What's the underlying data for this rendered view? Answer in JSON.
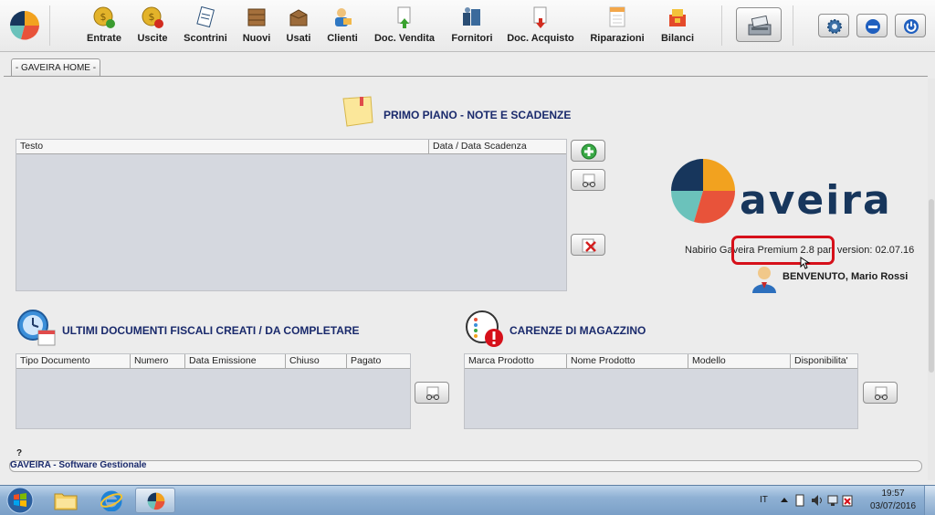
{
  "toolbar": {
    "items": [
      {
        "label": "Entrate",
        "icon": "coin-in-icon"
      },
      {
        "label": "Uscite",
        "icon": "coin-out-icon"
      },
      {
        "label": "Scontrini",
        "icon": "receipt-icon"
      },
      {
        "label": "Nuovi",
        "icon": "new-box-icon"
      },
      {
        "label": "Usati",
        "icon": "used-box-icon"
      },
      {
        "label": "Clienti",
        "icon": "client-icon"
      },
      {
        "label": "Doc. Vendita",
        "icon": "sale-doc-icon"
      },
      {
        "label": "Fornitori",
        "icon": "supplier-icon"
      },
      {
        "label": "Doc. Acquisto",
        "icon": "purchase-doc-icon"
      },
      {
        "label": "Riparazioni",
        "icon": "repair-icon"
      },
      {
        "label": "Bilanci",
        "icon": "balance-icon"
      }
    ]
  },
  "tab": {
    "label": "- GAVEIRA HOME -"
  },
  "notes": {
    "title": "PRIMO PIANO  -  NOTE E SCADENZE",
    "columns": [
      "Testo",
      "Data / Data Scadenza"
    ]
  },
  "brand": {
    "logo_text": "aveira",
    "version": "Nabirio Gaveira Premium 2.8 part version: 02.07.16",
    "welcome": "BENVENUTO, Mario Rossi"
  },
  "documents": {
    "title": "ULTIMI DOCUMENTI FISCALI CREATI / DA COMPLETARE",
    "columns": [
      "Tipo Documento",
      "Numero",
      "Data Emissione",
      "Chiuso",
      "Pagato"
    ]
  },
  "stock": {
    "title": "CARENZE DI MAGAZZINO",
    "columns": [
      "Marca Prodotto",
      "Nome Prodotto",
      "Modello",
      "Disponibilita'"
    ]
  },
  "footer": {
    "question": "?",
    "status": "GAVEIRA - Software Gestionale"
  },
  "taskbar": {
    "lang": "IT",
    "time": "19:57",
    "date": "03/07/2016"
  },
  "colors": {
    "title_blue": "#1a2a6c",
    "logo_teal": "#6bc2bb",
    "logo_navy": "#17365c",
    "logo_orange": "#f2a21f",
    "logo_red": "#e8533a",
    "highlight_red": "#d6101a",
    "table_gray": "#d5d8df"
  }
}
